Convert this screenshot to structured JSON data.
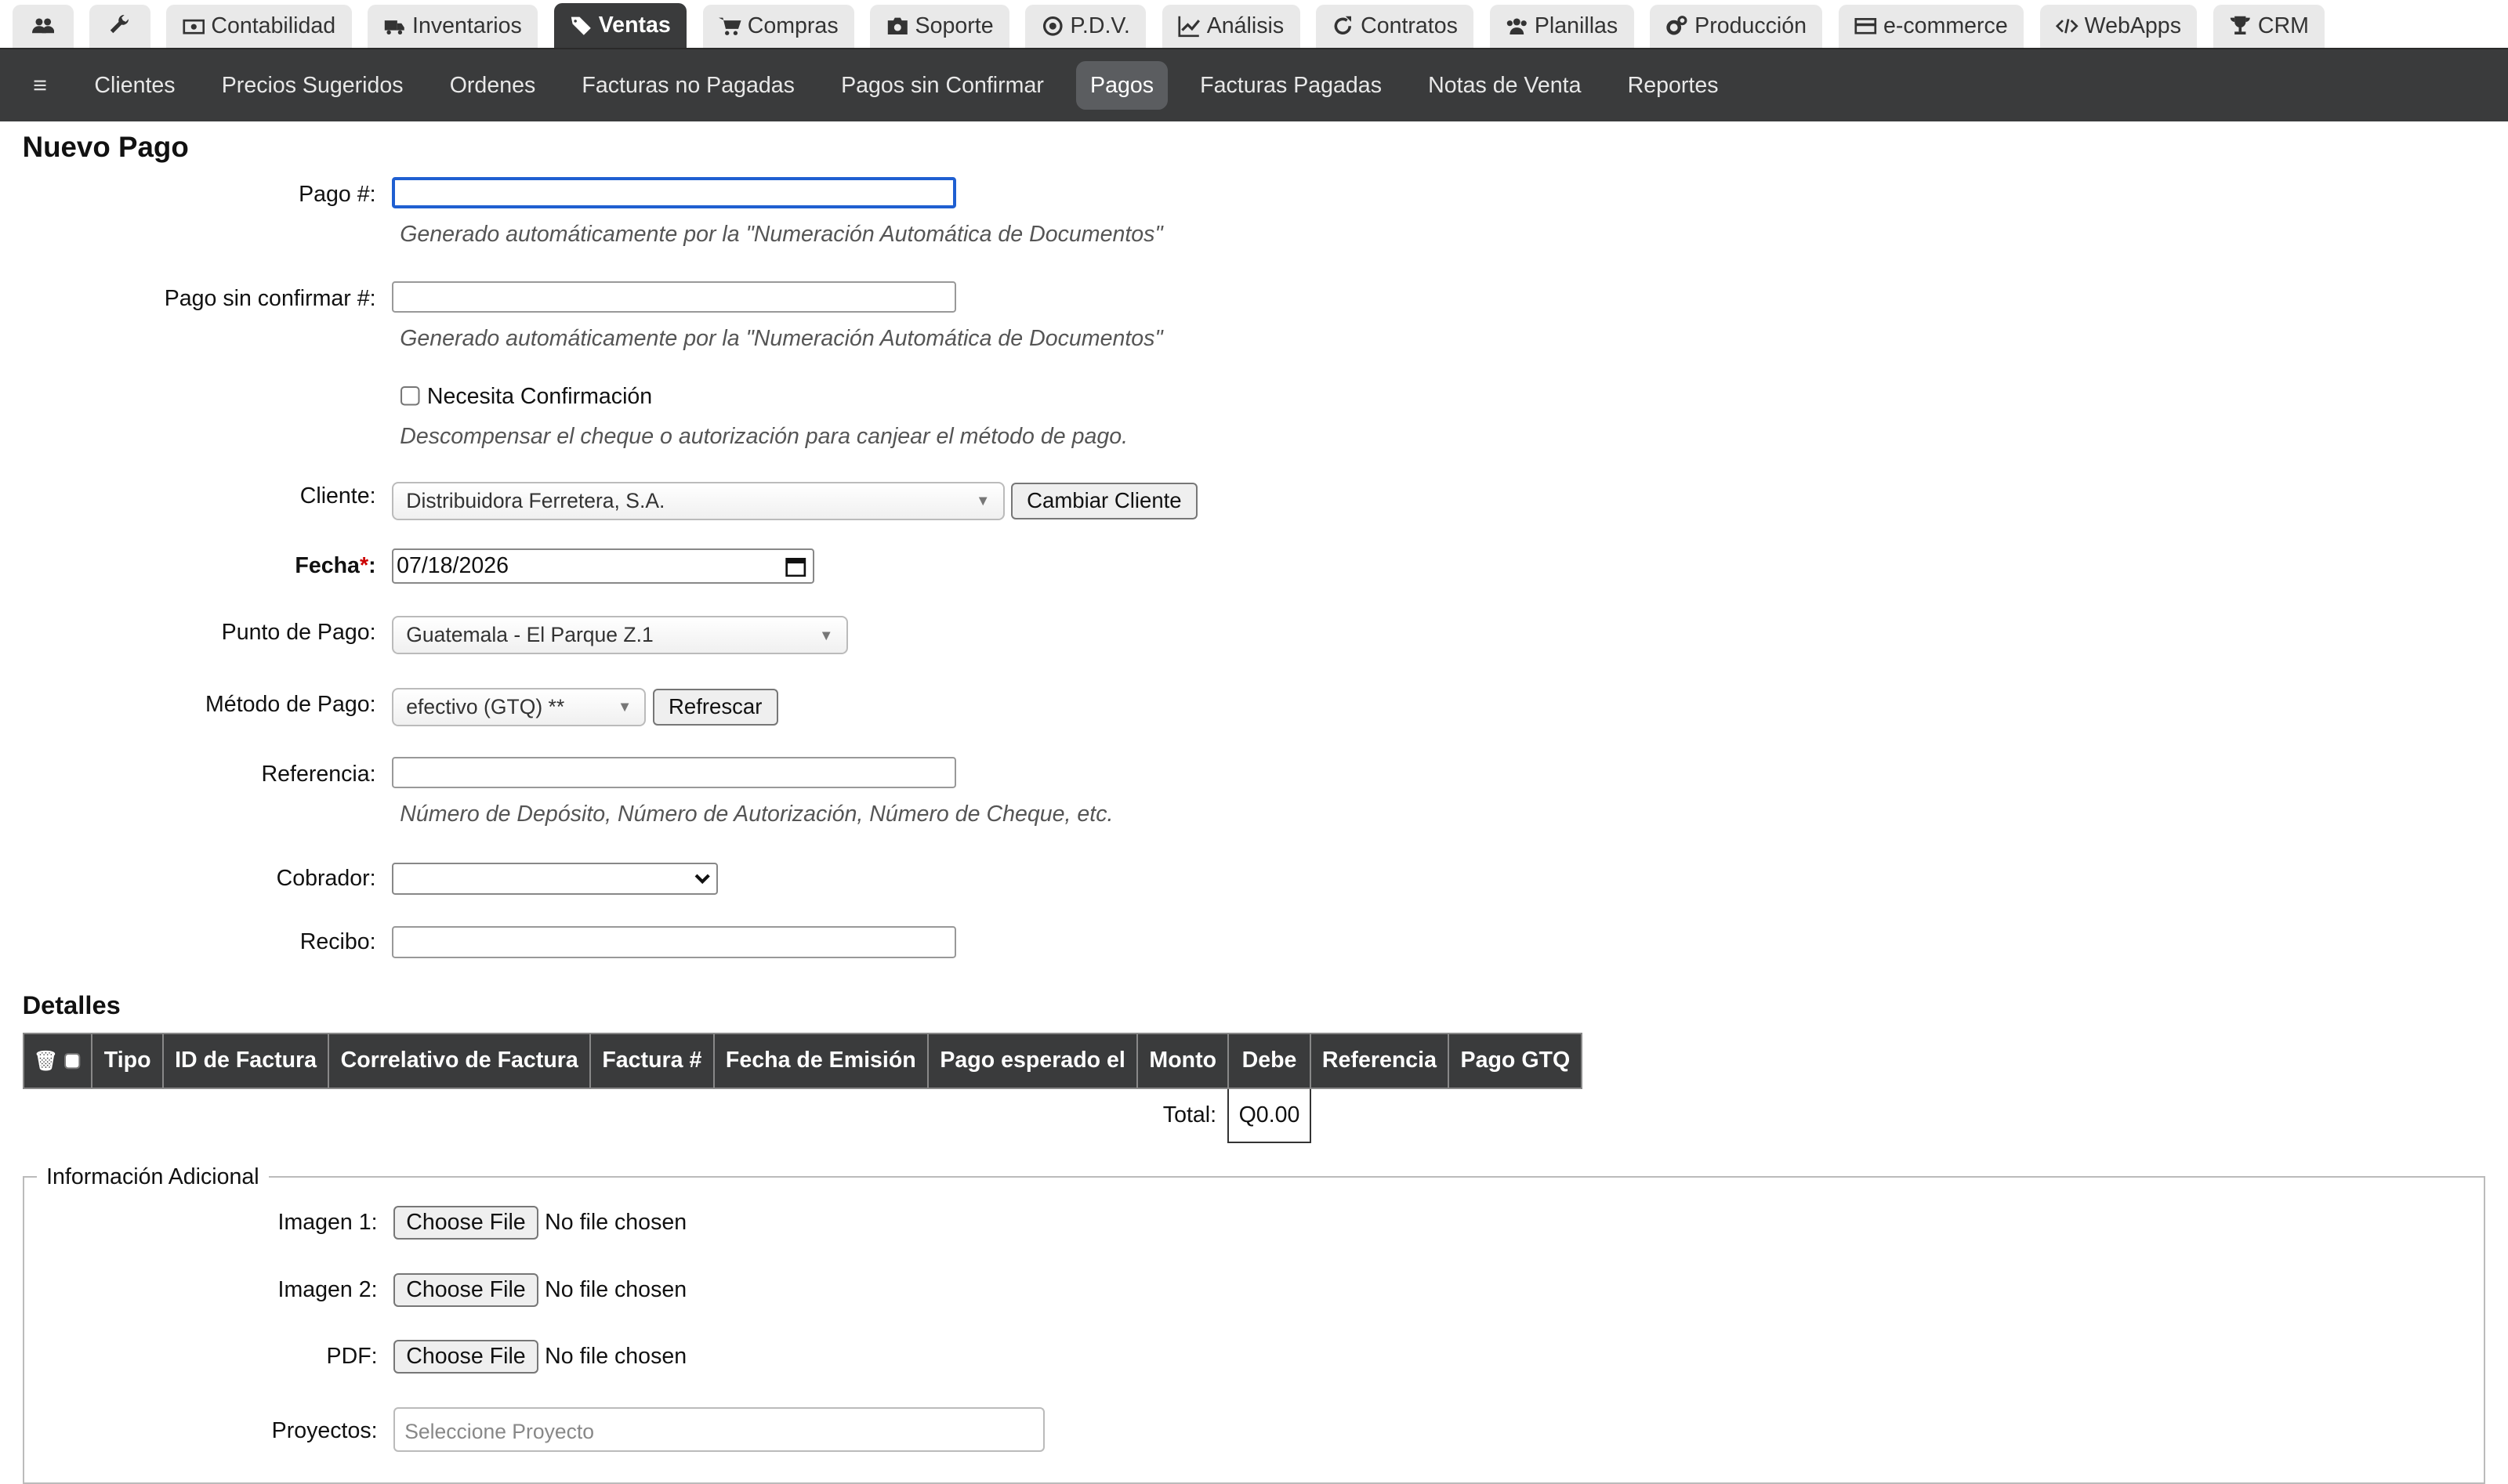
{
  "top_tabs": [
    {
      "label": "",
      "icon": "users-icon",
      "active": false
    },
    {
      "label": "",
      "icon": "wrench-icon",
      "active": false
    },
    {
      "label": "Contabilidad",
      "icon": "money-icon",
      "active": false
    },
    {
      "label": "Inventarios",
      "icon": "truck-icon",
      "active": false
    },
    {
      "label": "Ventas",
      "icon": "tags-icon",
      "active": true
    },
    {
      "label": "Compras",
      "icon": "cart-icon",
      "active": false
    },
    {
      "label": "Soporte",
      "icon": "camera-icon",
      "active": false
    },
    {
      "label": "P.D.V.",
      "icon": "target-icon",
      "active": false
    },
    {
      "label": "Análisis",
      "icon": "chart-icon",
      "active": false
    },
    {
      "label": "Contratos",
      "icon": "refresh-icon",
      "active": false
    },
    {
      "label": "Planillas",
      "icon": "group-icon",
      "active": false
    },
    {
      "label": "Producción",
      "icon": "cogs-icon",
      "active": false
    },
    {
      "label": "e-commerce",
      "icon": "card-icon",
      "active": false
    },
    {
      "label": "WebApps",
      "icon": "code-icon",
      "active": false
    },
    {
      "label": "CRM",
      "icon": "trophy-icon",
      "active": false
    }
  ],
  "sub_nav": {
    "menu_icon": "≡",
    "items": [
      {
        "label": "Clientes",
        "active": false
      },
      {
        "label": "Precios Sugeridos",
        "active": false
      },
      {
        "label": "Ordenes",
        "active": false
      },
      {
        "label": "Facturas no Pagadas",
        "active": false
      },
      {
        "label": "Pagos sin Confirmar",
        "active": false
      },
      {
        "label": "Pagos",
        "active": true
      },
      {
        "label": "Facturas Pagadas",
        "active": false
      },
      {
        "label": "Notas de Venta",
        "active": false
      },
      {
        "label": "Reportes",
        "active": false
      }
    ]
  },
  "form": {
    "title": "Nuevo Pago",
    "pago_num": {
      "label": "Pago #:",
      "value": "",
      "help": "Generado automáticamente por la \"Numeración Automática de Documentos\""
    },
    "pago_sin_confirmar": {
      "label": "Pago sin confirmar #:",
      "value": "",
      "help": "Generado automáticamente por la \"Numeración Automática de Documentos\""
    },
    "necesita_confirmacion": {
      "label": "Necesita Confirmación",
      "checked": false,
      "help": "Descompensar el cheque o autorización para canjear el método de pago."
    },
    "cliente": {
      "label": "Cliente:",
      "value": "Distribuidora Ferretera, S.A.",
      "button": "Cambiar Cliente"
    },
    "fecha": {
      "label": "Fecha",
      "required_mark": "*",
      "colon": ":",
      "value": "07/18/2026"
    },
    "punto_pago": {
      "label": "Punto de Pago:",
      "value": "Guatemala - El Parque Z.1"
    },
    "metodo_pago": {
      "label": "Método de Pago:",
      "value": "efectivo (GTQ) **",
      "button": "Refrescar"
    },
    "referencia": {
      "label": "Referencia:",
      "value": "",
      "help": "Número de Depósito, Número de Autorización, Número de Cheque, etc."
    },
    "cobrador": {
      "label": "Cobrador:",
      "value": ""
    },
    "recibo": {
      "label": "Recibo:",
      "value": ""
    }
  },
  "details": {
    "title": "Detalles",
    "columns": [
      "Tipo",
      "ID de Factura",
      "Correlativo de Factura",
      "Factura #",
      "Fecha de Emisión",
      "Pago esperado el",
      "Monto",
      "Debe",
      "Referencia",
      "Pago GTQ"
    ],
    "total_label": "Total:",
    "total_value": "Q0.00"
  },
  "extra": {
    "legend": "Información Adicional",
    "files": [
      {
        "label": "Imagen 1:",
        "button": "Choose File",
        "status": "No file chosen"
      },
      {
        "label": "Imagen 2:",
        "button": "Choose File",
        "status": "No file chosen"
      },
      {
        "label": "PDF:",
        "button": "Choose File",
        "status": "No file chosen"
      }
    ],
    "proyectos": {
      "label": "Proyectos:",
      "placeholder": "Seleccione Proyecto"
    }
  },
  "colors": {
    "nav_dark": "#3a3b3c",
    "focus_blue": "#1f5fd1",
    "required_red": "#cc0000"
  }
}
